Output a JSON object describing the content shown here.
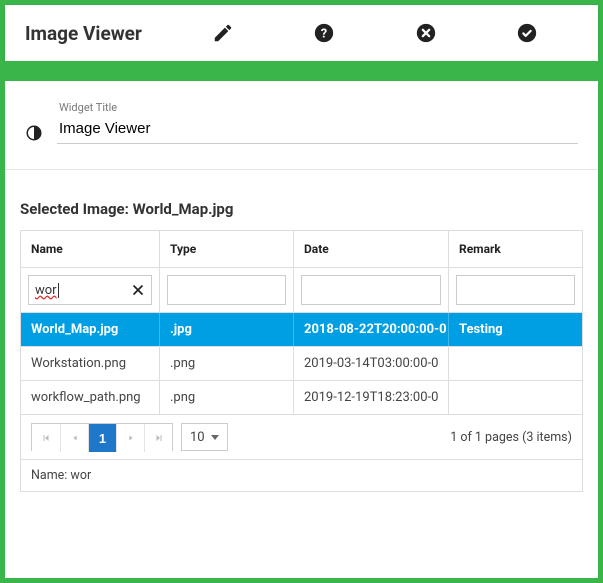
{
  "header": {
    "title": "Image Viewer"
  },
  "widget": {
    "label": "Widget Title",
    "value": "Image Viewer"
  },
  "selection": {
    "label_prefix": "Selected Image: ",
    "selected_name": "World_Map.jpg"
  },
  "grid": {
    "columns": {
      "name": "Name",
      "type": "Type",
      "date": "Date",
      "remark": "Remark"
    },
    "filters": {
      "name": "wor",
      "type": "",
      "date": "",
      "remark": ""
    },
    "rows": [
      {
        "name": "World_Map.jpg",
        "type": ".jpg",
        "date": "2018-08-22T20:00:00-0",
        "remark": "Testing",
        "selected": true
      },
      {
        "name": "Workstation.png",
        "type": ".png",
        "date": "2019-03-14T03:00:00-0",
        "remark": "",
        "selected": false
      },
      {
        "name": "workflow_path.png",
        "type": ".png",
        "date": "2019-12-19T18:23:00-0",
        "remark": "",
        "selected": false
      }
    ]
  },
  "pager": {
    "current_page": "1",
    "page_size": "10",
    "info": "1 of 1 pages (3 items)"
  },
  "filter_summary": {
    "text": "Name: wor"
  }
}
